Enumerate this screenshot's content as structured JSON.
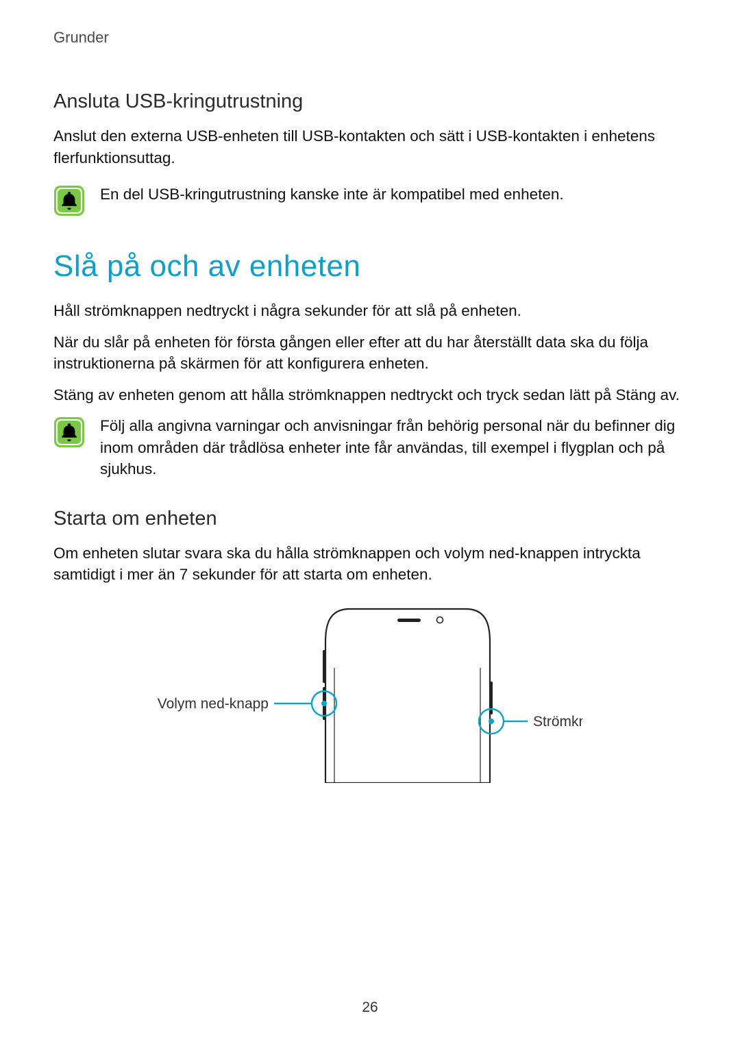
{
  "header": "Grunder",
  "section1": {
    "heading": "Ansluta USB-kringutrustning",
    "p1": "Anslut den externa USB-enheten till USB-kontakten och sätt i USB-kontakten i enhetens flerfunktionsuttag.",
    "note": "En del USB-kringutrustning kanske inte är kompatibel med enheten."
  },
  "section2": {
    "title": "Slå på och av enheten",
    "p1": "Håll strömknappen nedtryckt i några sekunder för att slå på enheten.",
    "p2": "När du slår på enheten för första gången eller efter att du har återställt data ska du följa instruktionerna på skärmen för att konfigurera enheten.",
    "p3": "Stäng av enheten genom att hålla strömknappen nedtryckt och tryck sedan lätt på Stäng av.",
    "note": "Följ alla angivna varningar och anvisningar från behörig personal när du befinner dig inom områden där trådlösa enheter inte får användas, till exempel i flygplan och på sjukhus."
  },
  "section3": {
    "heading": "Starta om enheten",
    "p1": "Om enheten slutar svara ska du hålla strömknappen och volym ned-knappen intryckta samtidigt i mer än 7 sekunder för att starta om enheten.",
    "label_left": "Volym ned-knapp",
    "label_right": "Strömknapp"
  },
  "pageNumber": "26",
  "colors": {
    "accent": "#0f9fc9",
    "noteIconBg": "#7ac943",
    "noteIconFg": "#000000",
    "callout": "#0aa6cf"
  }
}
